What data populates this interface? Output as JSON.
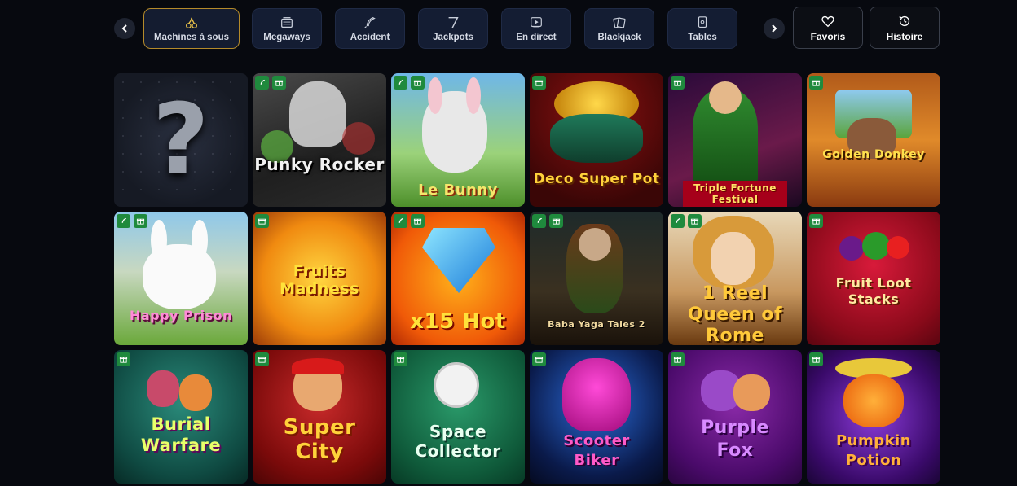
{
  "categories": [
    {
      "label": "Machines à sous",
      "icon": "cherries-icon",
      "active": true
    },
    {
      "label": "Megaways",
      "icon": "slot-machine-icon",
      "active": false
    },
    {
      "label": "Accident",
      "icon": "rocket-icon",
      "active": false
    },
    {
      "label": "Jackpots",
      "icon": "seven-icon",
      "active": false
    },
    {
      "label": "En direct",
      "icon": "live-play-icon",
      "active": false
    },
    {
      "label": "Blackjack",
      "icon": "cards-icon",
      "active": false
    },
    {
      "label": "Tables",
      "icon": "table-cards-icon",
      "active": false
    }
  ],
  "actions": {
    "favorites_label": "Favoris",
    "history_label": "Histoire"
  },
  "games": [
    {
      "title": "?",
      "badges": []
    },
    {
      "title": "Punky Rocker",
      "badges": [
        "rocket",
        "gift"
      ]
    },
    {
      "title": "Le Bunny",
      "badges": [
        "rocket",
        "gift"
      ]
    },
    {
      "title": "Deco Super Pot",
      "badges": [
        "gift"
      ]
    },
    {
      "title": "Triple Fortune Festival",
      "badges": [
        "gift"
      ]
    },
    {
      "title": "Golden Donkey",
      "badges": [
        "gift"
      ]
    },
    {
      "title": "Happy Prison",
      "badges": [
        "rocket",
        "gift"
      ]
    },
    {
      "title": "Fruits Madness",
      "badges": [
        "gift"
      ]
    },
    {
      "title": "x15 Hot",
      "badges": [
        "rocket",
        "gift"
      ]
    },
    {
      "title": "Baba Yaga Tales 2",
      "badges": [
        "rocket",
        "gift"
      ]
    },
    {
      "title": "1 Reel Queen of Rome",
      "badges": [
        "rocket",
        "gift"
      ]
    },
    {
      "title": "Fruit Loot Stacks",
      "badges": [
        "gift"
      ]
    },
    {
      "title": "Burial Warfare",
      "badges": [
        "gift"
      ]
    },
    {
      "title": "Super City",
      "badges": [
        "gift"
      ]
    },
    {
      "title": "Space Collector",
      "badges": [
        "gift"
      ]
    },
    {
      "title": "Scooter Biker",
      "badges": [
        "gift"
      ]
    },
    {
      "title": "Purple Fox",
      "badges": [
        "gift"
      ]
    },
    {
      "title": "Pumpkin Potion",
      "badges": [
        "gift"
      ]
    }
  ],
  "colors": {
    "background": "#07090f",
    "category_bg": "#141d33",
    "active_border": "#b48a2a",
    "badge_green": "#1f8a3d"
  }
}
